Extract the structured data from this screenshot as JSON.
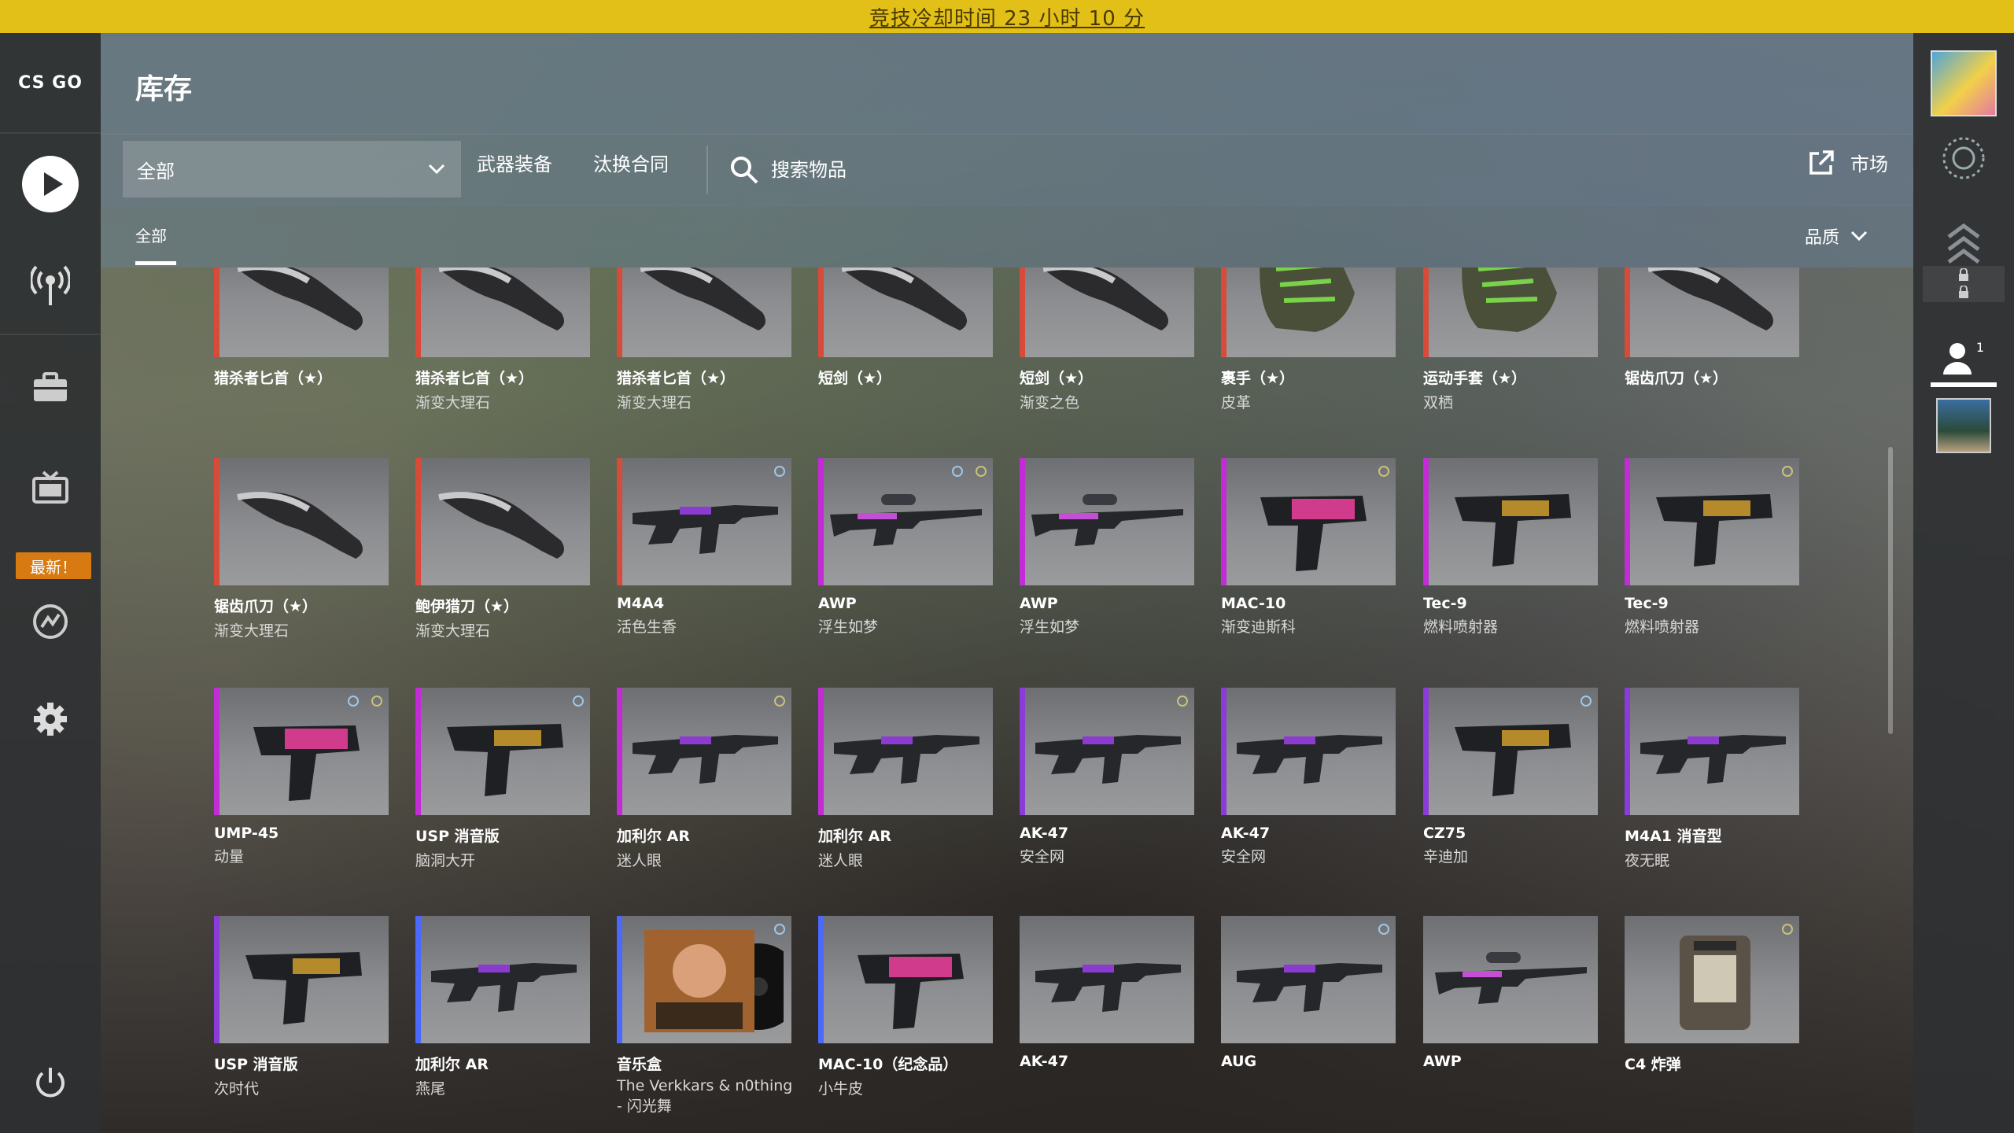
{
  "banner": {
    "text": "竞技冷却时间 23 小时 10 分"
  },
  "left_nav": {
    "logo_text": "CS GO",
    "new_badge": "最新！",
    "items": [
      {
        "icon": "play-icon"
      },
      {
        "icon": "broadcast-icon"
      },
      {
        "icon": "briefcase-icon"
      },
      {
        "icon": "tv-icon"
      },
      {
        "icon": "news-icon"
      },
      {
        "icon": "gear-icon"
      },
      {
        "icon": "power-icon"
      }
    ]
  },
  "header": {
    "title": "库存"
  },
  "toolbar": {
    "filter_value": "全部",
    "tabs": [
      "武器装备",
      "汰换合同"
    ],
    "search_placeholder": "搜索物品",
    "market_label": "市场"
  },
  "subtabs": {
    "active": "全部",
    "sort_label": "品质"
  },
  "right_panel": {
    "friend_count": "1"
  },
  "colors": {
    "banner": "#e2c018",
    "rarity_covert": "#d84a3a",
    "rarity_classified": "#c22bd6",
    "rarity_restricted": "#8a3bd8",
    "rarity_milspec": "#4b69ff",
    "rarity_consumer": "#b0c3d9",
    "badge_new": "#d77a12"
  },
  "inventory": [
    {
      "name": "猎杀者匕首（★）",
      "sub": "",
      "rarity": "covert",
      "icon": "knife-icon"
    },
    {
      "name": "猎杀者匕首（★）",
      "sub": "渐变大理石",
      "rarity": "covert",
      "icon": "knife-icon"
    },
    {
      "name": "猎杀者匕首（★）",
      "sub": "渐变大理石",
      "rarity": "covert",
      "icon": "knife-icon"
    },
    {
      "name": "短剑（★）",
      "sub": "",
      "rarity": "covert",
      "icon": "knife-icon"
    },
    {
      "name": "短剑（★）",
      "sub": "渐变之色",
      "rarity": "covert",
      "icon": "knife-icon"
    },
    {
      "name": "裹手（★）",
      "sub": "皮革",
      "rarity": "covert",
      "icon": "gloves-icon"
    },
    {
      "name": "运动手套（★）",
      "sub": "双栖",
      "rarity": "covert",
      "icon": "gloves-icon"
    },
    {
      "name": "锯齿爪刀（★）",
      "sub": "",
      "rarity": "covert",
      "icon": "knife-icon"
    },
    {
      "name": "锯齿爪刀（★）",
      "sub": "渐变大理石",
      "rarity": "covert",
      "icon": "knife-icon"
    },
    {
      "name": "鲍伊猎刀（★）",
      "sub": "渐变大理石",
      "rarity": "covert",
      "icon": "knife-icon"
    },
    {
      "name": "M4A4",
      "sub": "活色生香",
      "rarity": "covert",
      "icon": "rifle-icon"
    },
    {
      "name": "AWP",
      "sub": "浮生如梦",
      "rarity": "classified",
      "icon": "sniper-icon"
    },
    {
      "name": "AWP",
      "sub": "浮生如梦",
      "rarity": "classified",
      "icon": "sniper-icon"
    },
    {
      "name": "MAC-10",
      "sub": "渐变迪斯科",
      "rarity": "classified",
      "icon": "smg-icon"
    },
    {
      "name": "Tec-9",
      "sub": "燃料喷射器",
      "rarity": "classified",
      "icon": "pistol-icon"
    },
    {
      "name": "Tec-9",
      "sub": "燃料喷射器",
      "rarity": "classified",
      "icon": "pistol-icon"
    },
    {
      "name": "UMP-45",
      "sub": "动量",
      "rarity": "classified",
      "icon": "smg-icon"
    },
    {
      "name": "USP 消音版",
      "sub": "脑洞大开",
      "rarity": "classified",
      "icon": "pistol-icon"
    },
    {
      "name": "加利尔 AR",
      "sub": "迷人眼",
      "rarity": "classified",
      "icon": "rifle-icon"
    },
    {
      "name": "加利尔 AR",
      "sub": "迷人眼",
      "rarity": "classified",
      "icon": "rifle-icon"
    },
    {
      "name": "AK-47",
      "sub": "安全网",
      "rarity": "restricted",
      "icon": "rifle-icon"
    },
    {
      "name": "AK-47",
      "sub": "安全网",
      "rarity": "restricted",
      "icon": "rifle-icon"
    },
    {
      "name": "CZ75",
      "sub": "辛迪加",
      "rarity": "restricted",
      "icon": "pistol-icon"
    },
    {
      "name": "M4A1 消音型",
      "sub": "夜无眠",
      "rarity": "restricted",
      "icon": "rifle-icon"
    },
    {
      "name": "USP 消音版",
      "sub": "次时代",
      "rarity": "restricted",
      "icon": "pistol-icon"
    },
    {
      "name": "加利尔 AR",
      "sub": "燕尾",
      "rarity": "milspec",
      "icon": "rifle-icon"
    },
    {
      "name": "音乐盒",
      "sub": "The Verkkars & n0thing",
      "sub2": "- 闪光舞",
      "rarity": "milspec",
      "icon": "music-kit-icon"
    },
    {
      "name": "MAC-10（纪念品）",
      "sub": "小牛皮",
      "rarity": "milspec",
      "icon": "smg-icon"
    },
    {
      "name": "AK-47",
      "sub": "",
      "rarity": "none",
      "icon": "rifle-icon"
    },
    {
      "name": "AUG",
      "sub": "",
      "rarity": "none",
      "icon": "rifle-icon"
    },
    {
      "name": "AWP",
      "sub": "",
      "rarity": "none",
      "icon": "sniper-icon"
    },
    {
      "name": "C4 炸弹",
      "sub": "",
      "rarity": "none",
      "icon": "c4-icon"
    }
  ]
}
